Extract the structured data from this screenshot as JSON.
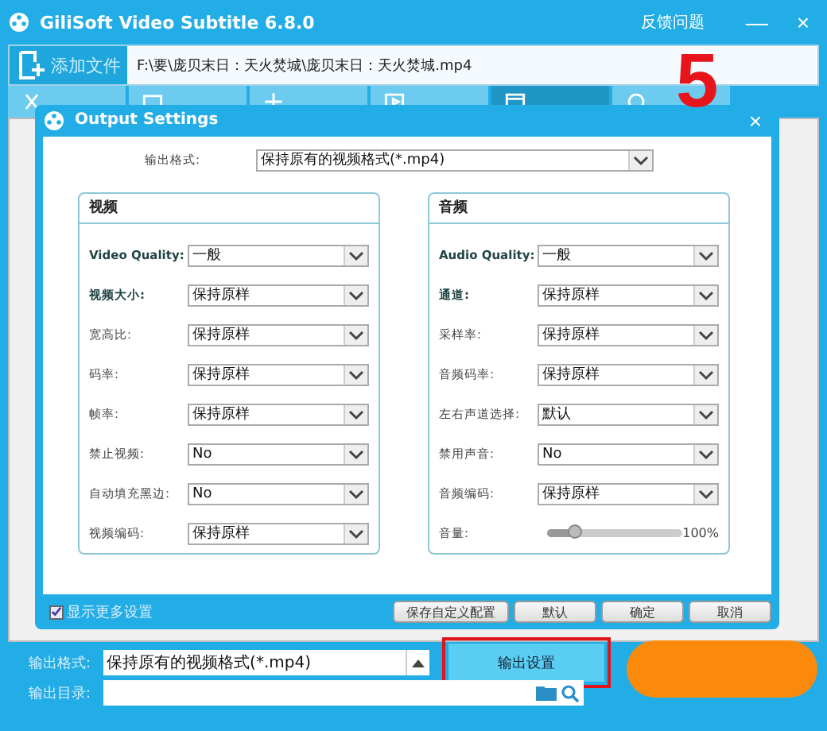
{
  "window": {
    "title": "GiliSoft Video Subtitle 6.8.0",
    "feedback": "反馈问题",
    "minimize": "—",
    "close": "×"
  },
  "file_bar": {
    "add_label": "添加文件",
    "path": "F:\\要\\庞贝末日：天火焚城\\庞贝末日：天火焚城.mp4"
  },
  "tabs": [
    {
      "selected": false
    },
    {
      "selected": false
    },
    {
      "selected": false
    },
    {
      "selected": false
    },
    {
      "selected": true
    },
    {
      "selected": false
    }
  ],
  "annotation": "5",
  "dialog": {
    "title": "Output Settings",
    "close": "×",
    "format_label": "输出格式:",
    "format_value": "保持原有的视频格式(*.mp4)",
    "groups": [
      {
        "title": "视频",
        "rows": [
          {
            "kind": "select",
            "label": "Video Quality:",
            "bold": true,
            "value": "一般"
          },
          {
            "kind": "select",
            "label": "视频大小:",
            "bold": true,
            "value": "保持原样"
          },
          {
            "kind": "select",
            "label": "宽高比:",
            "bold": false,
            "value": "保持原样"
          },
          {
            "kind": "select",
            "label": "码率:",
            "bold": false,
            "value": "保持原样"
          },
          {
            "kind": "select",
            "label": "帧率:",
            "bold": false,
            "value": "保持原样"
          },
          {
            "kind": "select",
            "label": "禁止视频:",
            "bold": false,
            "value": "No"
          },
          {
            "kind": "select",
            "label": "自动填充黑边:",
            "bold": false,
            "value": "No"
          },
          {
            "kind": "select",
            "label": "视频编码:",
            "bold": false,
            "value": "保持原样"
          }
        ]
      },
      {
        "title": "音频",
        "rows": [
          {
            "kind": "select",
            "label": "Audio Quality:",
            "bold": true,
            "value": "一般"
          },
          {
            "kind": "select",
            "label": "通道:",
            "bold": true,
            "value": "保持原样"
          },
          {
            "kind": "select",
            "label": "采样率:",
            "bold": false,
            "value": "保持原样"
          },
          {
            "kind": "select",
            "label": "音频码率:",
            "bold": false,
            "value": "保持原样"
          },
          {
            "kind": "select",
            "label": "左右声道选择:",
            "bold": false,
            "value": "默认"
          },
          {
            "kind": "select",
            "label": "禁用声音:",
            "bold": false,
            "value": "No"
          },
          {
            "kind": "select",
            "label": "音频编码:",
            "bold": false,
            "value": "保持原样"
          },
          {
            "kind": "slider",
            "label": "音量:",
            "bold": false,
            "level": 0.2,
            "reading": "100%"
          }
        ]
      }
    ],
    "more": {
      "label": "显示更多设置",
      "checked": true
    },
    "buttons": [
      "保存自定义配置",
      "默认",
      "确定",
      "取消"
    ]
  },
  "bottom": {
    "format_label": "输出格式:",
    "format_value": "保持原有的视频格式(*.mp4)",
    "settings_button": "输出设置",
    "settings_highlighted": true,
    "dir_label": "输出目录:"
  }
}
